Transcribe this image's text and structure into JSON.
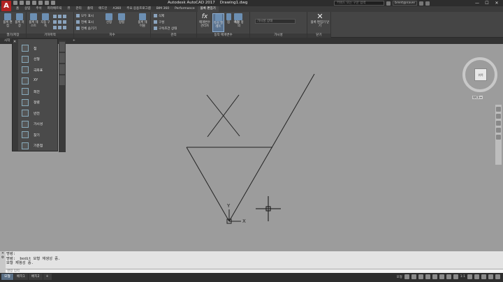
{
  "titlebar": {
    "title": "Autodesk AutoCAD 2017    Drawing1.dwg",
    "search_placeholder": "키워드 또는 구문 입력",
    "user": "brent@naver",
    "min": "—",
    "max": "☐",
    "close": "✕"
  },
  "ribbon_tabs": [
    "홈",
    "삽입",
    "주석",
    "파라메트릭",
    "뷰",
    "관리",
    "출력",
    "애드인",
    "A360",
    "주요 응용프로그램",
    "BIM 360",
    "Performance",
    "블록 편집기"
  ],
  "active_tab_index": 12,
  "groups": {
    "open_save": {
      "label": "열기/저장",
      "btn1": "블록 편집",
      "btn2": "블록 저장"
    },
    "geometric": {
      "label": "기하학적",
      "btn1": "블록 테스트",
      "btn2": "자동 구속"
    },
    "dimensional": {
      "label": "치수",
      "btn_show": "모두 표시",
      "btn_hide": "전체 표시",
      "btn_all": "전체 숨기기",
      "btn_linear": "선형",
      "btn_param": "정렬",
      "btn_table": "블록 테이블"
    },
    "manage": {
      "label": "관리",
      "btn_delete": "삭제",
      "btn_construct": "구성",
      "btn_status": "구속조건 상태"
    },
    "action_params": {
      "label": "동작 매개변수",
      "btn_param_mgr": "매개변수 관리자",
      "btn_authoring": "작성 팔레트",
      "btn_point": "점",
      "btn_move": "이동",
      "btn_attr": "속성 정의"
    },
    "visibility": {
      "label": "가시성",
      "dropdown_placeholder": "가시성 상태"
    },
    "close": {
      "label": "닫기",
      "btn_close": "블록 편집기 닫기"
    }
  },
  "file_tabs": [
    "시작",
    "Drawing1*"
  ],
  "palette": {
    "items": [
      {
        "label": "점",
        "icon": "point-param-icon"
      },
      {
        "label": "선형",
        "icon": "linear-param-icon"
      },
      {
        "label": "극좌표",
        "icon": "polar-param-icon"
      },
      {
        "label": "XY",
        "icon": "xy-param-icon"
      },
      {
        "label": "회전",
        "icon": "rotation-param-icon"
      },
      {
        "label": "정렬",
        "icon": "alignment-param-icon"
      },
      {
        "label": "반전",
        "icon": "flip-param-icon"
      },
      {
        "label": "가시성",
        "icon": "visibility-param-icon"
      },
      {
        "label": "찾기",
        "icon": "lookup-param-icon"
      },
      {
        "label": "기준점",
        "icon": "basepoint-param-icon"
      }
    ]
  },
  "viewcube": {
    "face": "위쪽",
    "wcs": "WCS ▾"
  },
  "ucs": {
    "x": "X",
    "y": "Y"
  },
  "command_line": {
    "history": [
      "명령:",
      "명령: _bedit 모형 재생성 중.",
      "모형 재생성 중."
    ],
    "input_placeholder": "명령 입력"
  },
  "layout_tabs": [
    "모형",
    "배치1",
    "배치2",
    "+"
  ],
  "status": {
    "scale": "1:1",
    "zoom_label": "모형"
  }
}
